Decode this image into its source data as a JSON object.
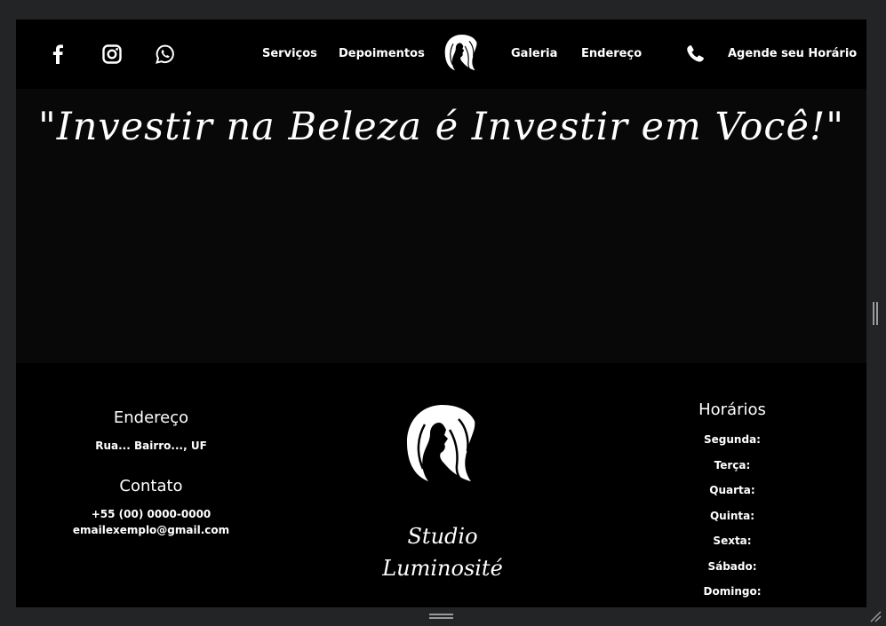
{
  "nav": {
    "social": [
      "facebook-icon",
      "instagram-icon",
      "whatsapp-icon"
    ],
    "links": [
      "Serviços",
      "Depoimentos",
      "Galeria",
      "Endereço"
    ],
    "cta_icon": "phone-icon",
    "cta": "Agende seu Horário"
  },
  "hero": {
    "quote": "\"Investir na Beleza é Investir em Você!\""
  },
  "footer": {
    "address": {
      "title": "Endereço",
      "text": "Rua... Bairro..., UF"
    },
    "contact": {
      "title": "Contato",
      "phone": "+55 (00) 0000-0000",
      "email": "emailexemplo@gmail.com"
    },
    "brand": {
      "line1": "Studio",
      "line2": "Luminosité"
    },
    "hours": {
      "title": "Horários",
      "days": [
        "Segunda:",
        "Terça:",
        "Quarta:",
        "Quinta:",
        "Sexta:",
        "Sábado:",
        "Domingo:"
      ]
    }
  },
  "colors": {
    "background": "#070707",
    "nav": "#000000",
    "text": "#ffffff",
    "chrome": "#232426"
  }
}
